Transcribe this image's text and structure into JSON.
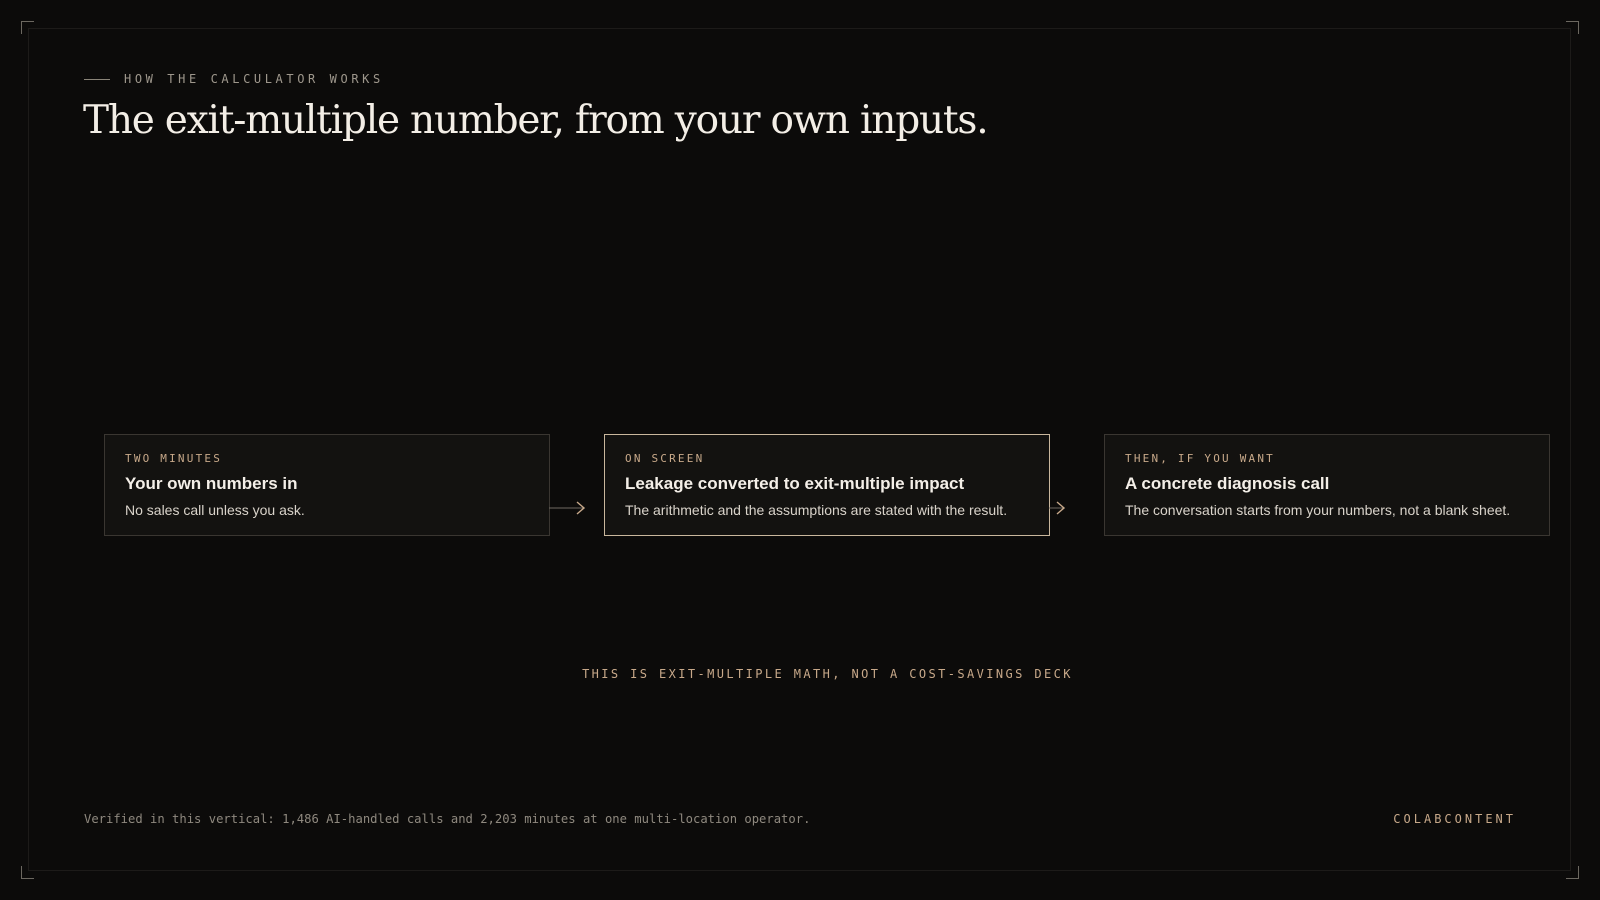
{
  "section": {
    "eyebrow": "HOW THE CALCULATOR WORKS",
    "title": "The exit-multiple number, from your own inputs."
  },
  "steps": [
    {
      "kicker": "TWO MINUTES",
      "title": "Your own numbers in",
      "description": "No sales call unless you ask.",
      "active": false
    },
    {
      "kicker": "ON SCREEN",
      "title": "Leakage converted to exit-multiple impact",
      "description": "The arithmetic and the assumptions are stated with the result.",
      "active": true
    },
    {
      "kicker": "THEN, IF YOU WANT",
      "title": "A concrete diagnosis call",
      "description": "The conversation starts from your numbers, not a blank sheet.",
      "active": false
    }
  ],
  "tagline": "THIS IS EXIT-MULTIPLE MATH, NOT A COST-SAVINGS DECK",
  "footer": {
    "note": "Verified in this vertical: 1,486 AI-handled calls and 2,203 minutes at one multi-location operator.",
    "brand": "COLABCONTENT"
  },
  "icons": {
    "step_connector": "arrow-right-icon"
  },
  "colors": {
    "background": "#0c0b0a",
    "accent": "#c8a98a",
    "active_border": "#c9b79d",
    "card_border": "#3a3631"
  }
}
